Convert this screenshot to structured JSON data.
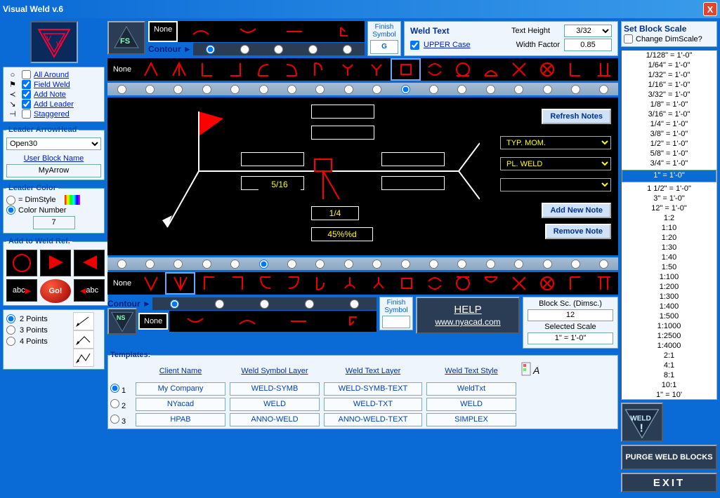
{
  "window": {
    "title": "Visual Weld v.6",
    "close": "X"
  },
  "flags": {
    "all_around": "All Around",
    "field_weld": "Field Weld",
    "add_note": "Add Note",
    "add_leader": "Add Leader",
    "staggered": "Staggered"
  },
  "leader": {
    "title": "Leader ArrowHead",
    "value": "Open30",
    "user_block_label": "User Block Name",
    "user_block": "MyArrow"
  },
  "color": {
    "title": "Leader Color",
    "dimstyle": "= DimStyle",
    "colornum": "Color Number",
    "val": "7"
  },
  "add_ref": {
    "title": "Add to Weld Ref.",
    "abc": "abc",
    "go": "Go!"
  },
  "points": {
    "p2": "2 Points",
    "p3": "3 Points",
    "p4": "4 Points"
  },
  "contour": {
    "label": "Contour ►",
    "none": "None"
  },
  "finish": {
    "title": "Finish Symbol",
    "val": "G"
  },
  "weldtext": {
    "title": "Weld Text",
    "upper": "UPPER Case",
    "txtheight_lbl": "Text Height",
    "txtheight": "3/32",
    "width_lbl": "Width Factor",
    "width": "0.85"
  },
  "canvas": {
    "refresh": "Refresh Notes",
    "note1": "TYP. MOM.",
    "note2": "PL. WELD",
    "note3": "",
    "add_note": "Add New Note",
    "remove_note": "Remove Note",
    "val_5_16": "5/16",
    "val_1_4": "1/4",
    "val_45": "45%%d"
  },
  "help": {
    "title": "HELP",
    "url": "www.nyacad.com"
  },
  "blockscale": {
    "title": "Block Sc. (Dimsc.)",
    "val": "12",
    "sel_title": "Selected Scale",
    "sel_val": "1\" = 1'-0\""
  },
  "setblock": {
    "title": "Set Block Scale",
    "change": "Change DimScale?",
    "selected": "1\" = 1'-0\"",
    "items": [
      "1/128\" = 1'-0\"",
      "1/64\" = 1'-0\"",
      "1/32\" = 1'-0\"",
      "1/16\" = 1'-0\"",
      "3/32\" = 1'-0\"",
      "1/8\" = 1'-0\"",
      "3/16\" = 1'-0\"",
      "1/4\" = 1'-0\"",
      "3/8\" = 1'-0\"",
      "1/2\" = 1'-0\"",
      "5/8\" = 1'-0\"",
      "3/4\" = 1'-0\"",
      "1\" = 1'-0\"",
      "1 1/2\" = 1'-0\"",
      "3\" = 1'-0\"",
      "12\" = 1'-0\"",
      "1:2",
      "1:10",
      "1:20",
      "1:30",
      "1:40",
      "1:50",
      "1:100",
      "1:200",
      "1:300",
      "1:400",
      "1:500",
      "1:1000",
      "1:2500",
      "1:4000",
      "2:1",
      "4:1",
      "8:1",
      "10:1",
      "1\" = 10'"
    ]
  },
  "templates": {
    "title": "Templates:",
    "headers": [
      "Client Name",
      "Weld Symbol Layer",
      "Weld Text Layer",
      "Weld Text Style"
    ],
    "rows": [
      {
        "n": "1",
        "client": "My Company",
        "sym": "WELD-SYMB",
        "txt": "WELD-SYMB-TEXT",
        "style": "WeldTxt"
      },
      {
        "n": "2",
        "client": "NYacad",
        "sym": "WELD",
        "txt": "WELD-TXT",
        "style": "WELD"
      },
      {
        "n": "3",
        "client": "HPAB",
        "sym": "ANNO-WELD",
        "txt": "ANNO-WELD-TEXT",
        "style": "SIMPLEX"
      }
    ]
  },
  "fs": "FS",
  "ns": "NS",
  "weld_btn": "WELD",
  "purge": "PURGE WELD BLOCKS",
  "exit": "EXIT"
}
